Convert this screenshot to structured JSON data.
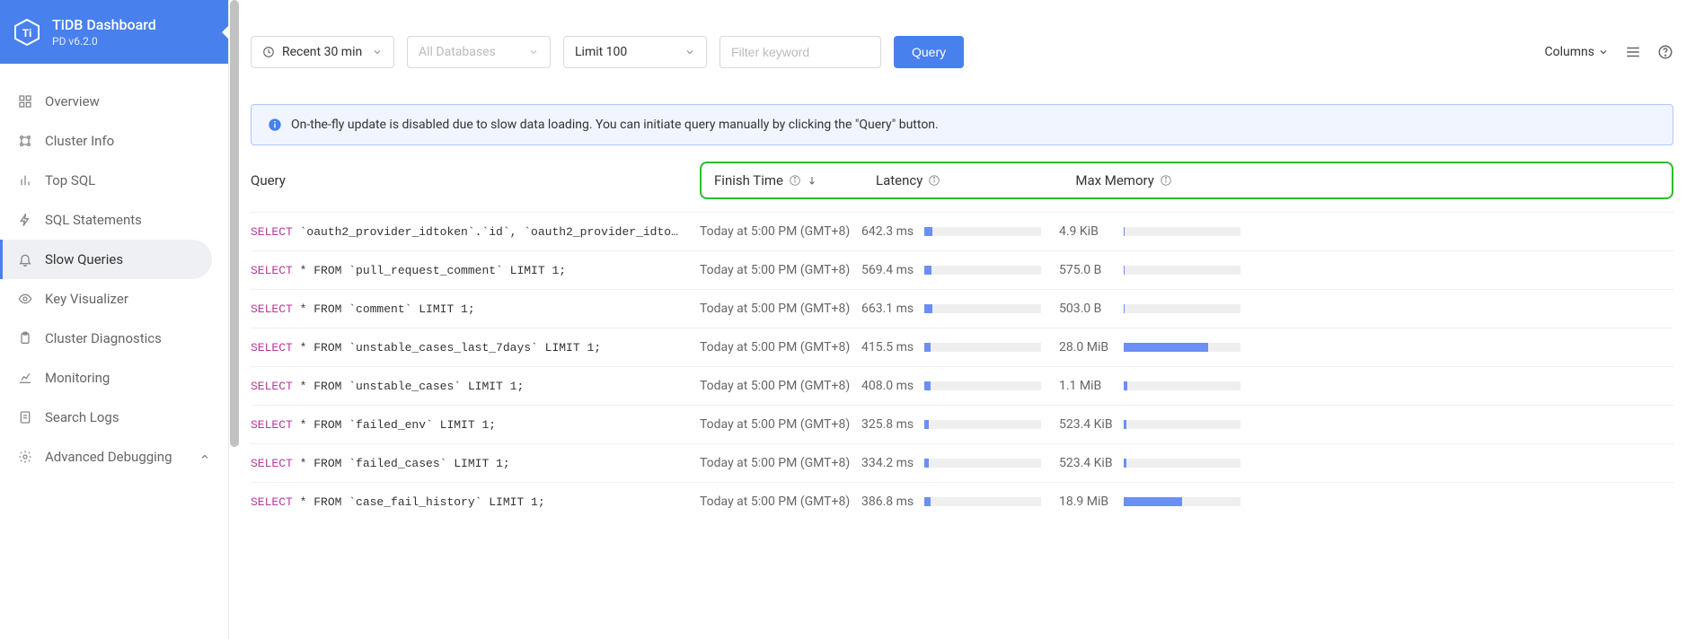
{
  "header": {
    "app_title": "TiDB Dashboard",
    "version": "PD v6.2.0"
  },
  "nav": {
    "items": [
      {
        "label": "Overview",
        "icon": "grid"
      },
      {
        "label": "Cluster Info",
        "icon": "cluster"
      },
      {
        "label": "Top SQL",
        "icon": "bar"
      },
      {
        "label": "SQL Statements",
        "icon": "bolt"
      },
      {
        "label": "Slow Queries",
        "icon": "bell",
        "active": true
      },
      {
        "label": "Key Visualizer",
        "icon": "eye"
      },
      {
        "label": "Cluster Diagnostics",
        "icon": "clipboard"
      },
      {
        "label": "Monitoring",
        "icon": "chart"
      },
      {
        "label": "Search Logs",
        "icon": "doc"
      },
      {
        "label": "Advanced Debugging",
        "icon": "gear",
        "expandable": true
      }
    ]
  },
  "toolbar": {
    "time_range": "Recent 30 min",
    "db_placeholder": "All Databases",
    "limit": "Limit 100",
    "filter_placeholder": "Filter keyword",
    "query_btn": "Query",
    "columns_label": "Columns"
  },
  "alert": {
    "text": "On-the-fly update is disabled due to slow data loading. You can initiate query manually by clicking the \"Query\" button."
  },
  "columns": {
    "query": "Query",
    "finish": "Finish Time",
    "latency": "Latency",
    "memory": "Max Memory"
  },
  "rows": [
    {
      "sql_kw": "SELECT",
      "sql_rest": " `oauth2_provider_idtoken`.`id`, `oauth2_provider_idto…",
      "finish": "Today at 5:00 PM (GMT+8)",
      "latency": "642.3 ms",
      "lat_pct": 7,
      "memory": "4.9 KiB",
      "mem_pct": 1
    },
    {
      "sql_kw": "SELECT",
      "sql_rest": " * FROM `pull_request_comment` LIMIT 1;",
      "finish": "Today at 5:00 PM (GMT+8)",
      "latency": "569.4 ms",
      "lat_pct": 6,
      "memory": "575.0 B",
      "mem_pct": 1
    },
    {
      "sql_kw": "SELECT",
      "sql_rest": " * FROM `comment` LIMIT 1;",
      "finish": "Today at 5:00 PM (GMT+8)",
      "latency": "663.1 ms",
      "lat_pct": 7,
      "memory": "503.0 B",
      "mem_pct": 1
    },
    {
      "sql_kw": "SELECT",
      "sql_rest": " * FROM `unstable_cases_last_7days` LIMIT 1;",
      "finish": "Today at 5:00 PM (GMT+8)",
      "latency": "415.5 ms",
      "lat_pct": 5,
      "memory": "28.0 MiB",
      "mem_pct": 72
    },
    {
      "sql_kw": "SELECT",
      "sql_rest": " * FROM `unstable_cases` LIMIT 1;",
      "finish": "Today at 5:00 PM (GMT+8)",
      "latency": "408.0 ms",
      "lat_pct": 5,
      "memory": "1.1 MiB",
      "mem_pct": 3
    },
    {
      "sql_kw": "SELECT",
      "sql_rest": " * FROM `failed_env` LIMIT 1;",
      "finish": "Today at 5:00 PM (GMT+8)",
      "latency": "325.8 ms",
      "lat_pct": 4,
      "memory": "523.4 KiB",
      "mem_pct": 2
    },
    {
      "sql_kw": "SELECT",
      "sql_rest": " * FROM `failed_cases` LIMIT 1;",
      "finish": "Today at 5:00 PM (GMT+8)",
      "latency": "334.2 ms",
      "lat_pct": 4,
      "memory": "523.4 KiB",
      "mem_pct": 2
    },
    {
      "sql_kw": "SELECT",
      "sql_rest": " * FROM `case_fail_history` LIMIT 1;",
      "finish": "Today at 5:00 PM (GMT+8)",
      "latency": "386.8 ms",
      "lat_pct": 5,
      "memory": "18.9 MiB",
      "mem_pct": 50
    }
  ]
}
